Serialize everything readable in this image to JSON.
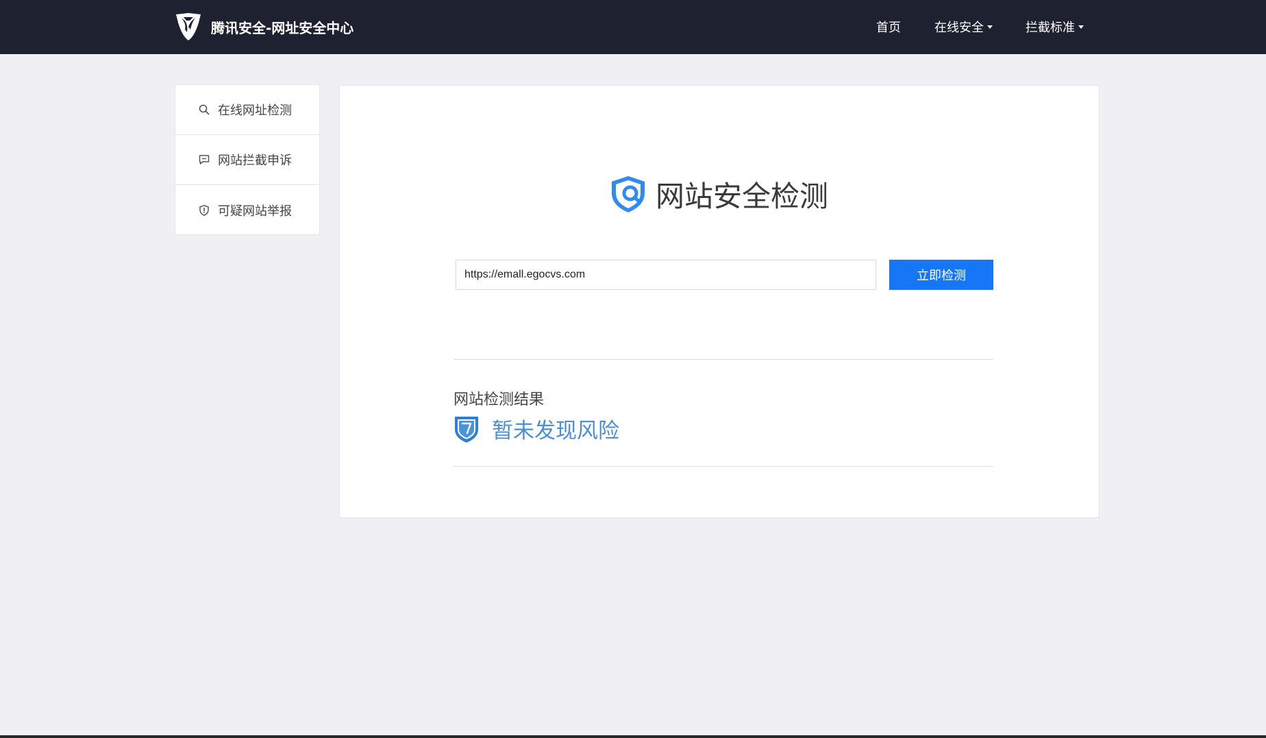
{
  "header": {
    "title": "腾讯安全-网址安全中心",
    "nav": {
      "home": "首页",
      "online_security": "在线安全",
      "block_standard": "拦截标准"
    }
  },
  "sidebar": {
    "items": [
      {
        "label": "在线网址检测",
        "icon": "search-icon"
      },
      {
        "label": "网站拦截申诉",
        "icon": "message-icon"
      },
      {
        "label": "可疑网站举报",
        "icon": "shield-alert-icon"
      }
    ]
  },
  "main": {
    "title": "网站安全检测",
    "url_input_value": "https://emall.egocvs.com",
    "check_button": "立即检测",
    "result_heading": "网站检测结果",
    "result_status": "暂未发现风险"
  },
  "colors": {
    "header_bg": "#1e2130",
    "page_bg": "#efeff4",
    "primary_button": "#1677f6",
    "status_blue": "#4a8fd9"
  }
}
